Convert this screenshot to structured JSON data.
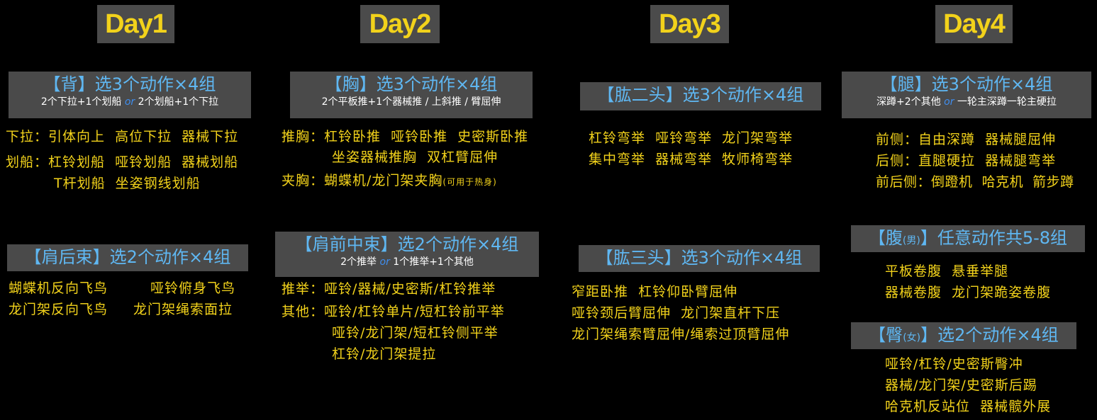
{
  "day1": {
    "title": "Day1",
    "back": {
      "title": "【背】选3个动作×4组",
      "sub_a": "2个下拉+1个划船",
      "sub_or": "or",
      "sub_b": "2个划船+1个下拉"
    },
    "back_lines": [
      "下拉：引体向上  高位下拉  器械下拉",
      "划船：杠铃划船  哑铃划船  器械划船",
      "T杆划船  坐姿钢线划船"
    ],
    "rear_delt": {
      "title": "【肩后束】选2个动作×4组"
    },
    "rear_delt_lines": [
      "蝴蝶机反向飞鸟",
      "哑铃俯身飞鸟",
      "龙门架反向飞鸟",
      "龙门架绳索面拉"
    ]
  },
  "day2": {
    "title": "Day2",
    "chest": {
      "title": "【胸】选3个动作×4组",
      "sub": "2个平板推+1个器械推 / 上斜推 / 臂屈伸"
    },
    "chest_lines": [
      "推胸：杠铃卧推  哑铃卧推  史密斯卧推",
      "坐姿器械推胸  双杠臂屈伸",
      "夹胸：蝴蝶机/龙门架夹胸",
      "(可用于热身)"
    ],
    "front_delt": {
      "title": "【肩前中束】选2个动作×4组",
      "sub_a": "2个推举",
      "sub_or": "or",
      "sub_b": "1个推举+1个其他"
    },
    "front_delt_lines": [
      "推举：哑铃/器械/史密斯/杠铃推举",
      "其他：哑铃/杠铃单片/短杠铃前平举",
      "哑铃/龙门架/短杠铃侧平举",
      "杠铃/龙门架提拉"
    ]
  },
  "day3": {
    "title": "Day3",
    "biceps": {
      "title": "【肱二头】选3个动作×4组"
    },
    "biceps_lines": [
      "杠铃弯举  哑铃弯举  龙门架弯举",
      "集中弯举  器械弯举  牧师椅弯举"
    ],
    "triceps": {
      "title": "【肱三头】选3个动作×4组"
    },
    "triceps_lines": [
      "窄距卧推  杠铃仰卧臂屈伸",
      "哑铃颈后臂屈伸  龙门架直杆下压",
      "龙门架绳索臂屈伸/绳索过顶臂屈伸"
    ]
  },
  "day4": {
    "title": "Day4",
    "legs": {
      "title": "【腿】选3个动作×4组",
      "sub_a": "深蹲+2个其他",
      "sub_or": "or",
      "sub_b": "一轮主深蹲一轮主硬拉"
    },
    "legs_lines": [
      "前侧：自由深蹲  器械腿屈伸",
      "后侧：直腿硬拉  器械腿弯举",
      "前后侧：倒蹬机  哈克机  箭步蹲"
    ],
    "abs": {
      "title_a": "【腹",
      "title_small": "(男)",
      "title_b": "】任意动作共5-8组"
    },
    "abs_lines": [
      "平板卷腹  悬垂举腿",
      "器械卷腹  龙门架跪姿卷腹"
    ],
    "glutes": {
      "title_a": "【臀",
      "title_small": "(女)",
      "title_b": "】选2个动作×4组"
    },
    "glutes_lines": [
      "哑铃/杠铃/史密斯臀冲",
      "器械/龙门架/史密斯后踢",
      "哈克机反站位  器械髋外展"
    ]
  }
}
